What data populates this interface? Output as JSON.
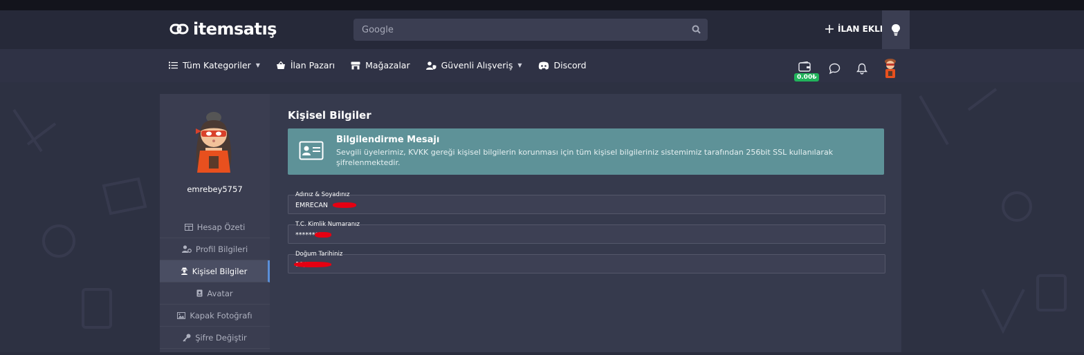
{
  "header": {
    "logo": "itemsatış",
    "search_placeholder": "Google",
    "add_listing": "İLAN EKLE"
  },
  "nav": {
    "items": [
      {
        "label": "Tüm Kategoriler",
        "caret": true
      },
      {
        "label": "İlan Pazarı",
        "caret": false
      },
      {
        "label": "Mağazalar",
        "caret": false
      },
      {
        "label": "Güvenli Alışveriş",
        "caret": true
      },
      {
        "label": "Discord",
        "caret": false
      }
    ],
    "wallet_balance": "0.00₺"
  },
  "sidebar": {
    "username": "emrebey5757",
    "menu": [
      {
        "label": "Hesap Özeti",
        "icon": "table-icon"
      },
      {
        "label": "Profil Bilgileri",
        "icon": "user-gear-icon"
      },
      {
        "label": "Kişisel Bilgiler",
        "icon": "user-secret-icon",
        "active": true
      },
      {
        "label": "Avatar",
        "icon": "id-badge-icon"
      },
      {
        "label": "Kapak Fotoğrafı",
        "icon": "image-icon"
      },
      {
        "label": "Şifre Değiştir",
        "icon": "key-icon"
      }
    ]
  },
  "main": {
    "title": "Kişisel Bilgiler",
    "alert": {
      "title": "Bilgilendirme Mesajı",
      "text": "Sevgili üyelerimiz, KVKK gereği kişisel bilgilerin korunması için tüm kişisel bilgileriniz sistemimiz tarafından 256bit SSL kullanılarak şifrelenmektedir."
    },
    "fields": [
      {
        "label": "Adınız & Soyadınız",
        "value": "EMRECAN"
      },
      {
        "label": "T.C. Kimlik Numaranız",
        "value": "*********"
      },
      {
        "label": "Doğum Tarihiniz",
        "value": "11/02/"
      }
    ]
  },
  "colors": {
    "header_bg": "#262939",
    "nav_bg": "#2f3245",
    "alert_bg": "#5e9298",
    "wallet_badge": "#21b35b",
    "active_border": "#5a8fd8"
  }
}
